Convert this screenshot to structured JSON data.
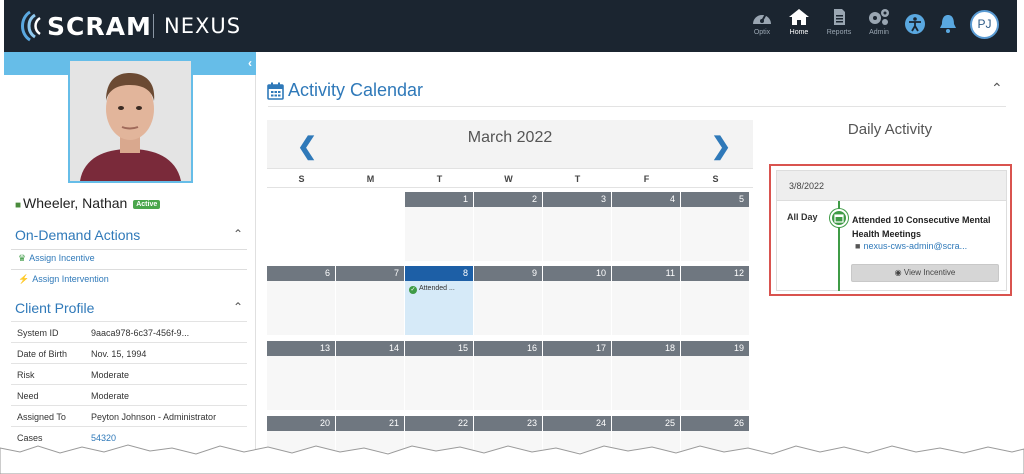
{
  "brand": {
    "name": "SCRAM",
    "product": "NEXUS"
  },
  "nav": [
    {
      "id": "optix",
      "label": "Optix",
      "icon": "gauge-icon",
      "active": false
    },
    {
      "id": "home",
      "label": "Home",
      "icon": "home-icon",
      "active": true
    },
    {
      "id": "reports",
      "label": "Reports",
      "icon": "document-icon",
      "active": false
    },
    {
      "id": "admin",
      "label": "Admin",
      "icon": "gears-icon",
      "active": false
    }
  ],
  "user": {
    "initials": "PJ"
  },
  "client": {
    "name": "Wheeler, Nathan",
    "status": "Active"
  },
  "on_demand": {
    "title": "On-Demand Actions",
    "actions": [
      {
        "label": "Assign Incentive",
        "icon": "trophy-icon"
      },
      {
        "label": "Assign Intervention",
        "icon": "bolt-icon"
      }
    ]
  },
  "profile": {
    "title": "Client Profile",
    "rows": [
      {
        "key": "System ID",
        "value": "9aaca978-6c37-456f-9..."
      },
      {
        "key": "Date of Birth",
        "value": "Nov. 15, 1994"
      },
      {
        "key": "Risk",
        "value": "Moderate"
      },
      {
        "key": "Need",
        "value": "Moderate"
      },
      {
        "key": "Assigned To",
        "value": "Peyton Johnson - Administrator"
      },
      {
        "key": "Cases",
        "value": "54320"
      }
    ]
  },
  "calendar": {
    "title": "Activity Calendar",
    "month": "March 2022",
    "weekdays": [
      "S",
      "M",
      "T",
      "W",
      "T",
      "F",
      "S"
    ],
    "weeks": [
      [
        "",
        "",
        "1",
        "2",
        "3",
        "4",
        "5"
      ],
      [
        "6",
        "7",
        "8",
        "9",
        "10",
        "11",
        "12"
      ],
      [
        "13",
        "14",
        "15",
        "16",
        "17",
        "18",
        "19"
      ],
      [
        "20",
        "21",
        "22",
        "23",
        "24",
        "25",
        "26"
      ]
    ],
    "selected_day": "8",
    "event_label": "Attended ..."
  },
  "daily": {
    "title": "Daily Activity",
    "date": "3/8/2022",
    "time": "All Day",
    "event_title": "Attended 10 Consecutive Mental Health Meetings",
    "event_user": "nexus-cws-admin@scra...",
    "button": "View Incentive"
  },
  "colors": {
    "topbar": "#1b2530",
    "accent": "#2f79b9",
    "band": "#66bde8",
    "success": "#3f9b46",
    "highlight_border": "#d9534f"
  }
}
